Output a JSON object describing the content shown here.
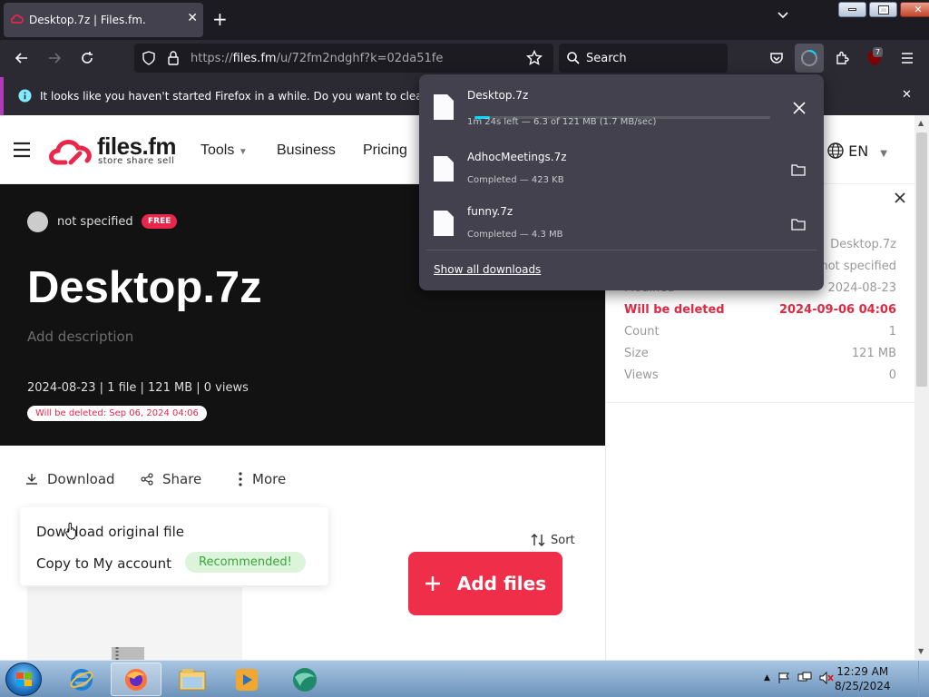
{
  "browser": {
    "tab_title": "Desktop.7z | Files.fm.",
    "url_host": "files.fm",
    "url_prefix": "https://",
    "url_path": "/u/72fm2ndghf?k=02da51fe",
    "search_placeholder": "Search",
    "ublock_count": "7",
    "notification": "It looks like you haven't started Firefox in a while. Do you want to clean it up for"
  },
  "site": {
    "logo_text": "files.fm",
    "logo_tagline": "store share sell",
    "menu": [
      "Tools",
      "Business",
      "Pricing"
    ],
    "language": "EN"
  },
  "file": {
    "owner": "not specified",
    "owner_badge": "FREE",
    "title": "Desktop.7z",
    "description_placeholder": "Add description",
    "meta": "2024-08-23 | 1 file | 121 MB | 0 views",
    "delete_notice": "Will be deleted: Sep 06, 2024 04:06"
  },
  "actions": {
    "download": "Download",
    "share": "Share",
    "more": "More",
    "menu_download_original": "Download original file",
    "menu_copy_account": "Copy to My account",
    "recommended": "Recommended!",
    "sort": "Sort",
    "add_files": "Add files"
  },
  "properties": [
    {
      "label": "",
      "value": "Desktop.7z"
    },
    {
      "label": "",
      "value": "not specified"
    },
    {
      "label": "Modified",
      "value": "2024-08-23"
    },
    {
      "label": "Will be deleted",
      "value": "2024-09-06 04:06"
    },
    {
      "label": "Count",
      "value": "1"
    },
    {
      "label": "Size",
      "value": "121 MB"
    },
    {
      "label": "Views",
      "value": "0"
    }
  ],
  "downloads": {
    "items": [
      {
        "name": "Desktop.7z",
        "status": "1m 24s left — 6.3 of 121 MB (1.7 MB/sec)",
        "progress": 0.052
      },
      {
        "name": "AdhocMeetings.7z",
        "status": "Completed — 423 KB"
      },
      {
        "name": "funny.7z",
        "status": "Completed — 4.3 MB"
      }
    ],
    "show_all": "Show all downloads"
  },
  "taskbar": {
    "time": "12:29 AM",
    "date": "8/25/2024"
  },
  "colors": {
    "brand_red": "#ef2e4a",
    "download_progress": "#00ddff"
  }
}
